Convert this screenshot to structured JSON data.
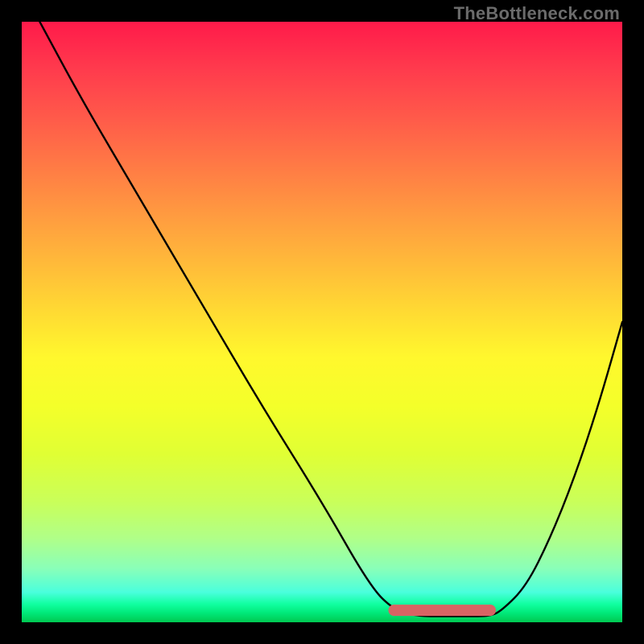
{
  "attribution": "TheBottleneck.com",
  "chart_data": {
    "type": "line",
    "title": "",
    "xlabel": "",
    "ylabel": "",
    "xlim": [
      0,
      100
    ],
    "ylim": [
      0,
      100
    ],
    "x": [
      3,
      10,
      20,
      30,
      40,
      50,
      58,
      62,
      66,
      70,
      74,
      78,
      80,
      84,
      88,
      92,
      96,
      100
    ],
    "values": [
      100,
      87,
      70,
      53,
      36,
      20,
      6,
      2,
      1,
      1,
      1,
      1,
      2,
      6,
      14,
      24,
      36,
      50
    ],
    "marker_points": [
      {
        "x": 62,
        "y": 2
      },
      {
        "x": 78,
        "y": 2
      }
    ],
    "gradient_stops": [
      {
        "pos": 0,
        "color": "#ff1a4a"
      },
      {
        "pos": 50,
        "color": "#fff030"
      },
      {
        "pos": 100,
        "color": "#00c850"
      }
    ]
  }
}
